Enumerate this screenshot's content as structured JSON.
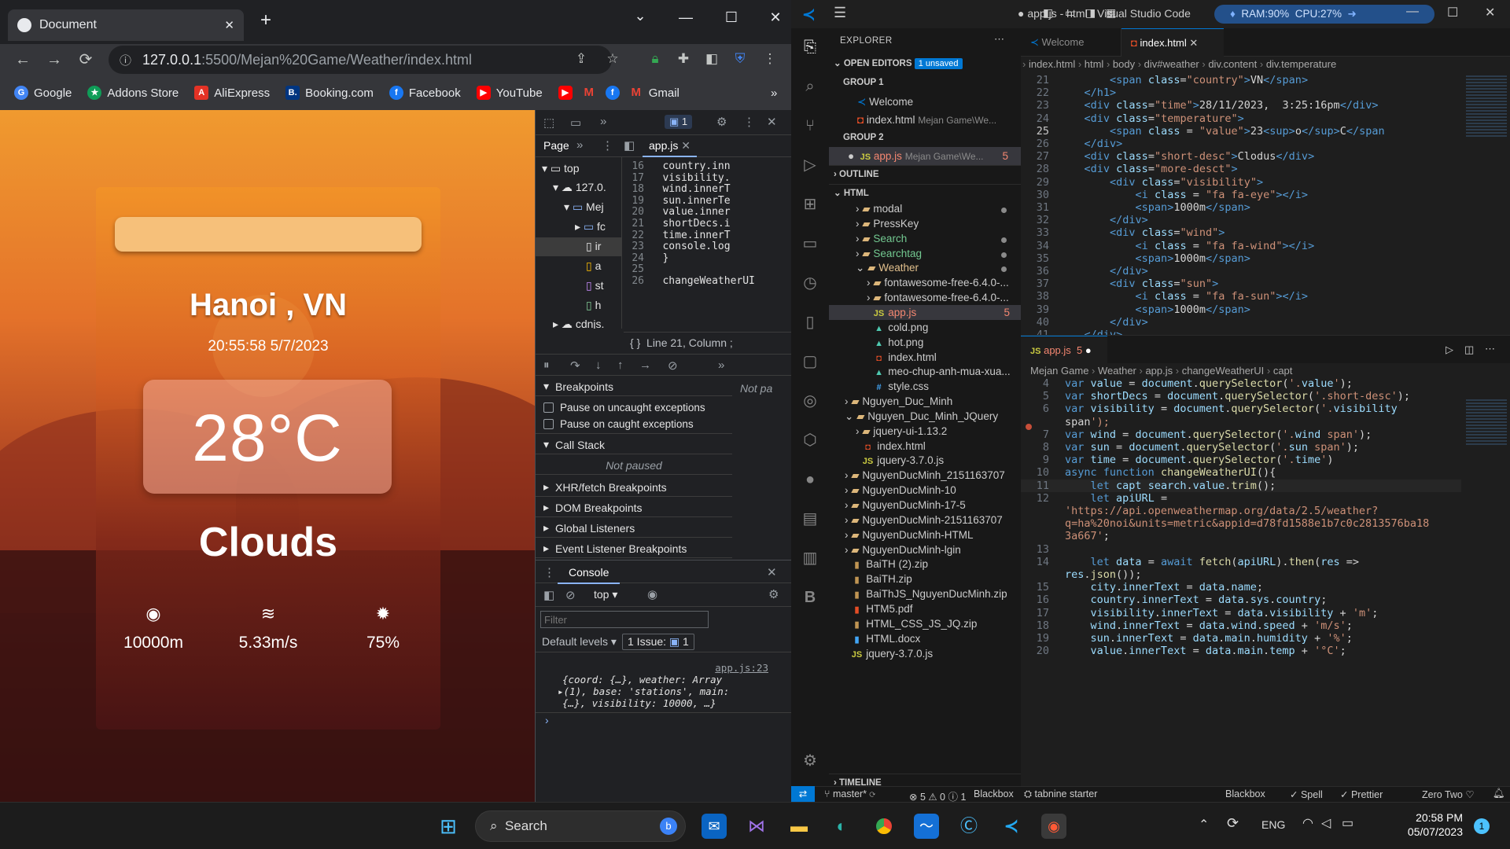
{
  "chrome": {
    "tab_title": "Document",
    "url_host": "127.0.0.1",
    "url_rest": ":5500/Mejan%20Game/Weather/index.html",
    "bookmarks": [
      "Google",
      "Addons Store",
      "AliExpress",
      "Booking.com",
      "Facebook",
      "YouTube",
      "Gmail"
    ],
    "devtools_issue_count": "1"
  },
  "weather": {
    "city": "Hanoi , VN",
    "time": "20:55:58 5/7/2023",
    "temperature": "28°C",
    "short_desc": "Clouds",
    "visibility": "10000m",
    "wind": "5.33m/s",
    "humidity": "75%"
  },
  "devtools": {
    "panel_page": "Page",
    "file_tab": "app.js",
    "tree": [
      "top",
      "127.0.",
      "Mej",
      "fc",
      "ir",
      "a",
      "st",
      "h",
      "cdnjs."
    ],
    "code_lines": [
      {
        "n": "16",
        "t": "country.inn"
      },
      {
        "n": "17",
        "t": "visibility."
      },
      {
        "n": "18",
        "t": "wind.innerT"
      },
      {
        "n": "19",
        "t": "sun.innerTe"
      },
      {
        "n": "20",
        "t": "value.inner"
      },
      {
        "n": "21",
        "t": "shortDecs.i"
      },
      {
        "n": "22",
        "t": "time.innerT"
      },
      {
        "n": "23",
        "t": "console.log"
      },
      {
        "n": "24",
        "t": "}"
      },
      {
        "n": "25",
        "t": ""
      },
      {
        "n": "26",
        "t": "changeWeatherUI"
      }
    ],
    "cursor_pos": "Line 21, Column ;",
    "not_paused_side": "Not pa",
    "breakpoints": "Breakpoints",
    "pause_uncaught": "Pause on uncaught exceptions",
    "pause_caught": "Pause on caught exceptions",
    "call_stack": "Call Stack",
    "not_paused": "Not paused",
    "xhr": "XHR/fetch Breakpoints",
    "dom": "DOM Breakpoints",
    "global": "Global Listeners",
    "event": "Event Listener Breakpoints",
    "console_tab": "Console",
    "ctx": "top",
    "filter_placeholder": "Filter",
    "levels": "Default levels",
    "issues": "1 Issue:",
    "issues_n": "1",
    "log_src": "app.js:23",
    "log1": "{coord: {…}, weather: Array",
    "log2": "(1), base: 'stations', main:",
    "log3": "{…}, visibility: 10000, …}"
  },
  "vscode": {
    "title": "● app.js - html - Visual Studio Code",
    "ram": "RAM:90%",
    "cpu": "CPU:27%",
    "explorer": "EXPLORER",
    "open_editors": "OPEN EDITORS",
    "unsaved": "1 unsaved",
    "group1": "GROUP 1",
    "welcome": "Welcome",
    "index_html": "index.html",
    "index_path": "Mejan Game\\We...",
    "group2": "GROUP 2",
    "appjs": "app.js",
    "appjs_path": "Mejan Game\\We...",
    "appjs_err": "5",
    "outline": "OUTLINE",
    "html": "HTML",
    "tree": [
      {
        "d": 1,
        "f": true,
        "n": "modal",
        "c": "#cccccc",
        "dot": true
      },
      {
        "d": 1,
        "f": true,
        "n": "PressKey",
        "c": "#cccccc"
      },
      {
        "d": 1,
        "f": true,
        "n": "Search",
        "c": "#73c991",
        "dot": true
      },
      {
        "d": 1,
        "f": true,
        "n": "Searchtag",
        "c": "#73c991",
        "dot": true
      },
      {
        "d": 1,
        "f": true,
        "n": "Weather",
        "c": "#e2c08d",
        "dot": true,
        "open": true
      },
      {
        "d": 2,
        "f": true,
        "n": "fontawesome-free-6.4.0-...",
        "c": "#cccccc"
      },
      {
        "d": 2,
        "f": true,
        "n": "fontawesome-free-6.4.0-...",
        "c": "#cccccc"
      },
      {
        "d": 2,
        "f": false,
        "n": "app.js",
        "c": "#f48771",
        "ic": "JS",
        "icc": "#cbcb41",
        "err": "5",
        "sel": true
      },
      {
        "d": 2,
        "f": false,
        "n": "cold.png",
        "c": "#cccccc",
        "ic": "▲",
        "icc": "#4ec9b0"
      },
      {
        "d": 2,
        "f": false,
        "n": "hot.png",
        "c": "#cccccc",
        "ic": "▲",
        "icc": "#4ec9b0"
      },
      {
        "d": 2,
        "f": false,
        "n": "index.html",
        "c": "#cccccc",
        "ic": "◘",
        "icc": "#e44d26"
      },
      {
        "d": 2,
        "f": false,
        "n": "meo-chup-anh-mua-xua...",
        "c": "#cccccc",
        "ic": "▲",
        "icc": "#4ec9b0"
      },
      {
        "d": 2,
        "f": false,
        "n": "style.css",
        "c": "#cccccc",
        "ic": "#",
        "icc": "#42a5f5"
      },
      {
        "d": 0,
        "f": true,
        "n": "Nguyen_Duc_Minh",
        "c": "#cccccc"
      },
      {
        "d": 0,
        "f": true,
        "n": "Nguyen_Duc_Minh_JQuery",
        "c": "#cccccc",
        "open": true
      },
      {
        "d": 1,
        "f": true,
        "n": "jquery-ui-1.13.2",
        "c": "#cccccc"
      },
      {
        "d": 1,
        "f": false,
        "n": "index.html",
        "c": "#cccccc",
        "ic": "◘",
        "icc": "#e44d26"
      },
      {
        "d": 1,
        "f": false,
        "n": "jquery-3.7.0.js",
        "c": "#cccccc",
        "ic": "JS",
        "icc": "#cbcb41"
      },
      {
        "d": 0,
        "f": true,
        "n": "NguyenDucMinh_2151163707",
        "c": "#cccccc"
      },
      {
        "d": 0,
        "f": true,
        "n": "NguyenDucMinh-10",
        "c": "#cccccc"
      },
      {
        "d": 0,
        "f": true,
        "n": "NguyenDucMinh-17-5",
        "c": "#cccccc"
      },
      {
        "d": 0,
        "f": true,
        "n": "NguyenDucMinh-2151163707",
        "c": "#cccccc"
      },
      {
        "d": 0,
        "f": true,
        "n": "NguyenDucMinh-HTML",
        "c": "#cccccc"
      },
      {
        "d": 0,
        "f": true,
        "n": "NguyenDucMinh-lgin",
        "c": "#cccccc"
      },
      {
        "d": 0,
        "f": false,
        "n": "BaiTH (2).zip",
        "c": "#cccccc",
        "ic": "▮",
        "icc": "#c09553"
      },
      {
        "d": 0,
        "f": false,
        "n": "BaiTH.zip",
        "c": "#cccccc",
        "ic": "▮",
        "icc": "#c09553"
      },
      {
        "d": 0,
        "f": false,
        "n": "BaiThJS_NguyenDucMinh.zip",
        "c": "#cccccc",
        "ic": "▮",
        "icc": "#c09553"
      },
      {
        "d": 0,
        "f": false,
        "n": "HTM5.pdf",
        "c": "#cccccc",
        "ic": "▮",
        "icc": "#e44d26"
      },
      {
        "d": 0,
        "f": false,
        "n": "HTML_CSS_JS_JQ.zip",
        "c": "#cccccc",
        "ic": "▮",
        "icc": "#c09553"
      },
      {
        "d": 0,
        "f": false,
        "n": "HTML.docx",
        "c": "#cccccc",
        "ic": "▮",
        "icc": "#42a5f5"
      },
      {
        "d": 0,
        "f": false,
        "n": "jquery-3.7.0.js",
        "c": "#cccccc",
        "ic": "JS",
        "icc": "#cbcb41"
      }
    ],
    "timeline": "TIMELINE",
    "tab_welcome": "Welcome",
    "tab_index": "index.html",
    "crumbs_top": [
      "index.html",
      "html",
      "body",
      "div#weather",
      "div.content",
      "div.temperature"
    ],
    "html_code": [
      {
        "n": "21",
        "h": "        <span class=\"country\">VN</span>"
      },
      {
        "n": "22",
        "h": "    </h1>"
      },
      {
        "n": "23",
        "h": "    <div class=\"time\">28/11/2023,  3:25:16pm</div>"
      },
      {
        "n": "24",
        "h": "    <div class=\"temperature\">"
      },
      {
        "n": "25",
        "h": "        <span class = \"value\">23<sup>o</sup>C</span"
      },
      {
        "n": "26",
        "h": "    </div>"
      },
      {
        "n": "27",
        "h": "    <div class=\"short-desc\">Clodus</div>"
      },
      {
        "n": "28",
        "h": "    <div class=\"more-desct\">"
      },
      {
        "n": "29",
        "h": "        <div class=\"visibility\">"
      },
      {
        "n": "30",
        "h": "            <i class = \"fa fa-eye\"></i>"
      },
      {
        "n": "31",
        "h": "            <span>1000m</span>"
      },
      {
        "n": "32",
        "h": "        </div>"
      },
      {
        "n": "33",
        "h": "        <div class=\"wind\">"
      },
      {
        "n": "34",
        "h": "            <i class = \"fa fa-wind\"></i>"
      },
      {
        "n": "35",
        "h": "            <span>1000m</span>"
      },
      {
        "n": "36",
        "h": "        </div>"
      },
      {
        "n": "37",
        "h": "        <div class=\"sun\">"
      },
      {
        "n": "38",
        "h": "            <i class = \"fa fa-sun\"></i>"
      },
      {
        "n": "39",
        "h": "            <span>1000m</span>"
      },
      {
        "n": "40",
        "h": "        </div>"
      },
      {
        "n": "41",
        "h": "    </div>"
      }
    ],
    "tab_appjs": "app.js",
    "tab_appjs_err": "5",
    "crumbs_bottom": [
      "Mejan Game",
      "Weather",
      "app.js",
      "changeWeatherUI",
      "capt"
    ],
    "js_code": [
      {
        "n": "4",
        "h": "var value = document.querySelector('.value');"
      },
      {
        "n": "5",
        "h": "var shortDecs = document.querySelector('.short-desc');"
      },
      {
        "n": "6",
        "h": "var visibility = document.querySelector('.visibility"
      },
      {
        "n": "",
        "h": "span');"
      },
      {
        "n": "7",
        "h": "var wind = document.querySelector('.wind span');"
      },
      {
        "n": "8",
        "h": "var sun = document.querySelector('.sun span');"
      },
      {
        "n": "9",
        "h": "var time = document.querySelector('.time')"
      },
      {
        "n": "10",
        "h": "async function changeWeatherUI(){"
      },
      {
        "n": "11",
        "h": "    let capt search.value.trim();"
      },
      {
        "n": "12",
        "h": "    let apiURL ="
      },
      {
        "n": "",
        "h": "'https://api.openweathermap.org/data/2.5/weather?"
      },
      {
        "n": "",
        "h": "q=ha%20noi&units=metric&appid=d78fd1588e1b7c0c2813576ba18"
      },
      {
        "n": "",
        "h": "3a667';"
      },
      {
        "n": "13",
        "h": ""
      },
      {
        "n": "14",
        "h": "    let data = await fetch(apiURL).then(res =>"
      },
      {
        "n": "",
        "h": "res.json());"
      },
      {
        "n": "15",
        "h": "    city.innerText = data.name;"
      },
      {
        "n": "16",
        "h": "    country.innerText = data.sys.country;"
      },
      {
        "n": "17",
        "h": "    visibility.innerText = data.visibility + 'm';"
      },
      {
        "n": "18",
        "h": "    wind.innerText = data.wind.speed + 'm/s';"
      },
      {
        "n": "19",
        "h": "    sun.innerText = data.main.humidity + '%';"
      },
      {
        "n": "20",
        "h": "    value.innerText = data.main.temp + '°C';"
      }
    ],
    "status": {
      "branch": "master*",
      "problems": "⊗ 5 ⚠ 0 ⓘ 1",
      "blackbox1": "Blackbox",
      "tabnine": "tabnine starter",
      "blackbox2": "Blackbox",
      "spell": "✓ Spell",
      "prettier": "✓ Prettier",
      "zero": "Zero Two ♡"
    }
  },
  "taskbar": {
    "search": "Search",
    "lang": "ENG",
    "clock_time": "20:58 PM",
    "clock_date": "05/07/2023",
    "notif": "1"
  },
  "colors": {
    "vscode_accent": "#0078d4",
    "chrome_bg": "#202124"
  }
}
